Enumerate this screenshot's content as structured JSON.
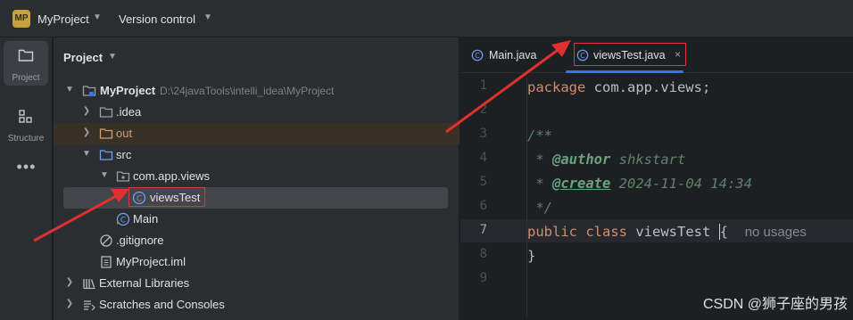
{
  "topbar": {
    "project_badge": "MP",
    "project_name": "MyProject",
    "vcs_label": "Version control"
  },
  "toolstrip": {
    "project_label": "Project",
    "structure_label": "Structure",
    "more_label": "•••"
  },
  "panel": {
    "title": "Project",
    "tree": [
      {
        "name": "MyProject",
        "hint": "D:\\24javaTools\\intelli_idea\\MyProject"
      },
      {
        "name": ".idea"
      },
      {
        "name": "out"
      },
      {
        "name": "src"
      },
      {
        "name": "com.app.views"
      },
      {
        "name": "viewsTest"
      },
      {
        "name": "Main"
      },
      {
        "name": ".gitignore"
      },
      {
        "name": "MyProject.iml"
      },
      {
        "name": "External Libraries"
      },
      {
        "name": "Scratches and Consoles"
      }
    ]
  },
  "editor": {
    "tabs": [
      {
        "name": "Main.java"
      },
      {
        "name": "viewsTest.java",
        "close": "×"
      }
    ],
    "line_numbers": [
      "1",
      "2",
      "3",
      "4",
      "5",
      "6",
      "7",
      "8",
      "9"
    ],
    "code": {
      "l1_kw": "package",
      "l1_rest": " com.app.views;",
      "l3": "/**",
      "l4_prefix": " * ",
      "l4_tag": "@author",
      "l4_val": " shkstart",
      "l5_prefix": " * ",
      "l5_tag": "@create",
      "l5_val": " 2024-11-04 14:34",
      "l6": " */",
      "l7_kw1": "public",
      "l7_kw2": "class",
      "l7_name": " viewsTest ",
      "l7_brace": "{",
      "l7_hint": "no usages",
      "l8": "}"
    }
  },
  "watermark": "CSDN @狮子座的男孩",
  "colors": {
    "accent": "#3574f0",
    "annotation_red": "#d9393b",
    "badge": "#c7a23c"
  }
}
